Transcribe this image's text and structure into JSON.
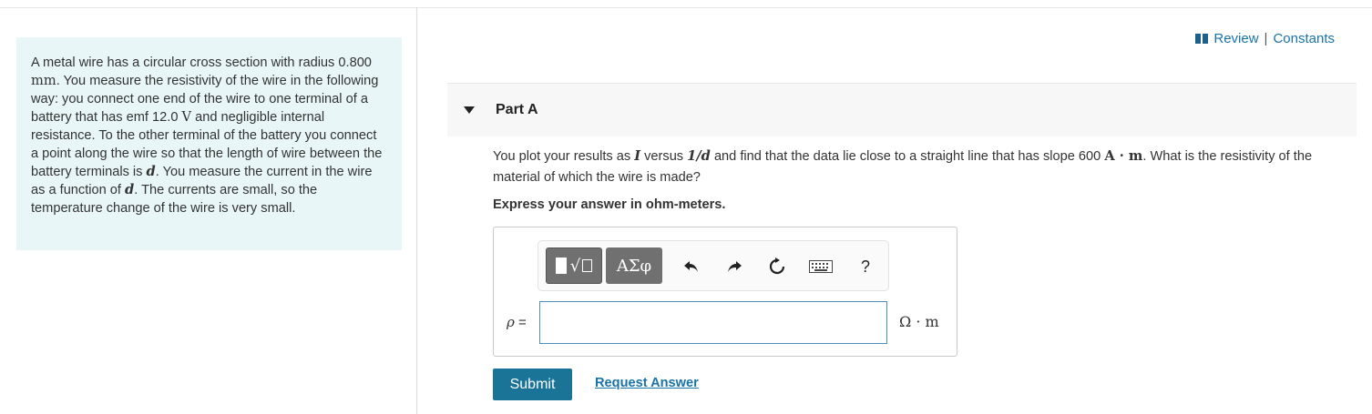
{
  "header": {
    "review": "Review",
    "separator": "|",
    "constants": "Constants"
  },
  "intro": {
    "s1": "A metal wire has a circular cross section with radius 0.800",
    "u1": "mm",
    "s2": ". You measure the resistivity of the wire in the following way: you connect one end of the wire to one terminal of a battery that has emf 12.0",
    "u2": "V",
    "s3": "and negligible internal resistance. To the other terminal of the battery you connect a point along the wire so that the length of wire between the battery terminals is",
    "v1": "d",
    "s4": ". You measure the current in the wire as a function of",
    "v2": "d",
    "s5": ". The currents are small, so the temperature change of the wire is very small."
  },
  "part": {
    "title": "Part A"
  },
  "question": {
    "q1": "You plot your results as",
    "qI": "I",
    "q2": "versus",
    "qfrac": "1/d",
    "q3": "and find that the data lie close to a straight line that has slope 600",
    "qunit": "A · m",
    "q4": ". What is the resistivity of the material of which the wire is made?",
    "instruction": "Express your answer in ohm-meters."
  },
  "answer": {
    "symbol": "ρ",
    "equals": "=",
    "value": "",
    "unit": "Ω · m"
  },
  "toolbar": {
    "greek_label": "ΑΣφ",
    "help_label": "?",
    "icons": [
      "templates-icon",
      "greek-letters-icon",
      "undo-icon",
      "redo-icon",
      "reset-icon",
      "keyboard-icon",
      "help-icon"
    ]
  },
  "actions": {
    "submit": "Submit",
    "request": "Request Answer"
  }
}
